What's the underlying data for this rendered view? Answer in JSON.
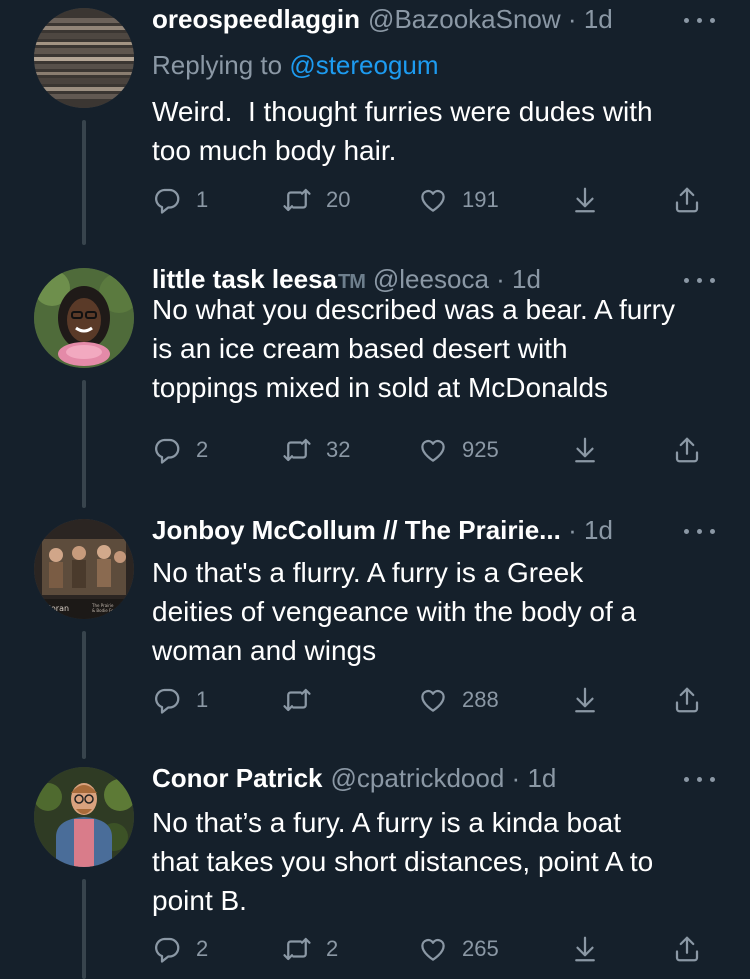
{
  "tweets": [
    {
      "name": "oreospeedlaggin",
      "badge": "",
      "handle": "@BazookaSnow",
      "time": "1d",
      "replying_label": "Replying to",
      "replying_to": "@stereogum",
      "lines": [
        "Weird.  I thought furries were dudes with",
        "too much body hair."
      ],
      "replies": "1",
      "retweets": "20",
      "likes": "191"
    },
    {
      "name": "little task leesa",
      "badge": "TM",
      "handle": "@leesoca",
      "time": "1d",
      "lines": [
        "No what you described was a bear. A furry",
        "is an ice cream based desert with",
        "toppings mixed in sold at McDonalds"
      ],
      "replies": "2",
      "retweets": "32",
      "likes": "925"
    },
    {
      "name": "Jonboy McCollum // The Prairie...",
      "badge": "",
      "handle": "",
      "time": "1d",
      "avatar_text": [
        "Moran",
        "The Prairie",
        "& Bodie Fest"
      ],
      "lines": [
        "No that's a flurry. A furry is a Greek",
        "deities of vengeance with the body of a",
        "woman and wings"
      ],
      "replies": "1",
      "retweets": "",
      "likes": "288"
    },
    {
      "name": "Conor Patrick",
      "badge": "",
      "handle": "@cpatrickdood",
      "time": "1d",
      "lines": [
        "No that’s a fury. A furry is a kinda boat",
        "that takes you short distances, point A to",
        "point B."
      ],
      "replies": "2",
      "retweets": "2",
      "likes": "265"
    }
  ],
  "separator": "·",
  "colors": {
    "background": "#15202b",
    "text": "#ffffff",
    "muted": "#8b98a5",
    "link": "#1d9bf0",
    "thread_line": "#38444d"
  },
  "icons": [
    "reply-icon",
    "retweet-icon",
    "like-icon",
    "download-icon",
    "share-icon",
    "more-icon"
  ]
}
